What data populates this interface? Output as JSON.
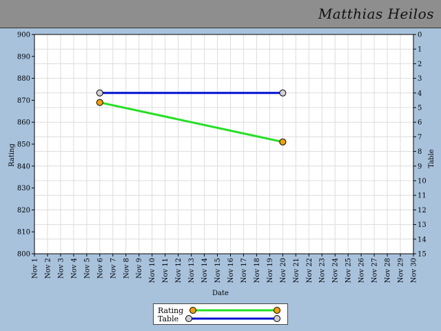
{
  "header": {
    "title": "Matthias Heilos"
  },
  "colors": {
    "background": "#a8c2dc",
    "header_bg": "#8e8e8e",
    "rating_line": "#22e022",
    "rating_marker": "#f5a000",
    "table_line": "#0010d0",
    "table_marker": "#d0d0d0"
  },
  "chart_data": {
    "type": "line",
    "xlabel": "Date",
    "ylabel": "Rating",
    "y2label": "Table",
    "categories": [
      "Nov 1",
      "Nov 2",
      "Nov 3",
      "Nov 4",
      "Nov 5",
      "Nov 6",
      "Nov 7",
      "Nov 8",
      "Nov 9",
      "Nov 10",
      "Nov 11",
      "Nov 12",
      "Nov 13",
      "Nov 14",
      "Nov 15",
      "Nov 16",
      "Nov 17",
      "Nov 18",
      "Nov 19",
      "Nov 20",
      "Nov 21",
      "Nov 22",
      "Nov 23",
      "Nov 24",
      "Nov 25",
      "Nov 26",
      "Nov 27",
      "Nov 28",
      "Nov 29",
      "Nov 30"
    ],
    "ylim": [
      800,
      900
    ],
    "yticks": [
      800,
      810,
      820,
      830,
      840,
      850,
      860,
      870,
      880,
      890,
      900
    ],
    "y2lim": [
      0,
      15
    ],
    "y2_inverted": true,
    "y2ticks": [
      0,
      1,
      2,
      3,
      4,
      5,
      6,
      7,
      8,
      9,
      10,
      11,
      12,
      13,
      14,
      15
    ],
    "grid": true,
    "legend_position": "bottom",
    "series": [
      {
        "name": "Rating",
        "axis": "left",
        "x": [
          "Nov 6",
          "Nov 20"
        ],
        "y": [
          869,
          851
        ]
      },
      {
        "name": "Table",
        "axis": "right",
        "x": [
          "Nov 6",
          "Nov 20"
        ],
        "y": [
          4,
          4
        ]
      }
    ]
  }
}
